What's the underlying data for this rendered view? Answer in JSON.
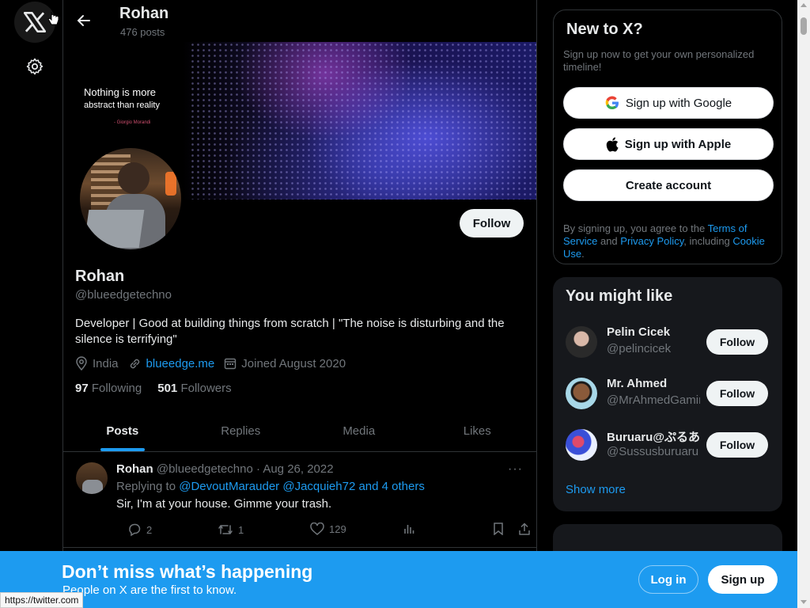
{
  "header": {
    "name": "Rohan",
    "posts_count": "476 posts"
  },
  "banner": {
    "quote_line1": "Nothing is more",
    "quote_line2": "abstract than reality",
    "quote_author": "- Giorgio Morandi"
  },
  "profile": {
    "follow_label": "Follow",
    "name": "Rohan",
    "handle": "@blueedgetechno",
    "bio": "Developer | Good at building things from scratch | \"The noise is disturbing and the silence is terrifying\"",
    "location": "India",
    "website": "blueedge.me",
    "joined": "Joined August 2020",
    "following_count": "97",
    "following_label": "Following",
    "followers_count": "501",
    "followers_label": "Followers"
  },
  "tabs": [
    "Posts",
    "Replies",
    "Media",
    "Likes"
  ],
  "tweet": {
    "author": "Rohan",
    "meta": "@blueedgetechno · Aug 26, 2022",
    "replying_prefix": "Replying to",
    "replying_to": "@DevoutMarauder @Jacquieh72 and 4 others",
    "text": "Sir, I'm at your house. Gimme your trash.",
    "reply_count": "2",
    "repost_count": "1",
    "like_count": "129",
    "more": "···"
  },
  "new_to_x": {
    "title": "New to X?",
    "subtitle": "Sign up now to get your own personalized timeline!",
    "google_label": "Sign up with Google",
    "apple_label": "Sign up with Apple",
    "create_label": "Create account",
    "legal_prefix": "By signing up, you agree to the ",
    "terms_link": "Terms of Service",
    "legal_and": " and ",
    "privacy_link": "Privacy Policy",
    "legal_including": ", including ",
    "cookie_link": "Cookie Use",
    "legal_end": "."
  },
  "you_might_like": {
    "title": "You might like",
    "follow_label": "Follow",
    "show_more": "Show more",
    "users": [
      {
        "name": "Pelin Cicek",
        "handle": "@pelincicek"
      },
      {
        "name": "Mr. Ahmed",
        "handle": "@MrAhmedGaming"
      },
      {
        "name": "Buruaru@ぷるあ",
        "handle": "@Sussusburuaru"
      }
    ]
  },
  "bottom_bar": {
    "title": "Don’t miss what’s happening",
    "subtitle": "People on X are the first to know.",
    "login_label": "Log in",
    "signup_label": "Sign up"
  },
  "status_url": "https://twitter.com",
  "colors": {
    "accent": "#1d9bf0",
    "background": "#000000",
    "muted": "#71767b"
  }
}
